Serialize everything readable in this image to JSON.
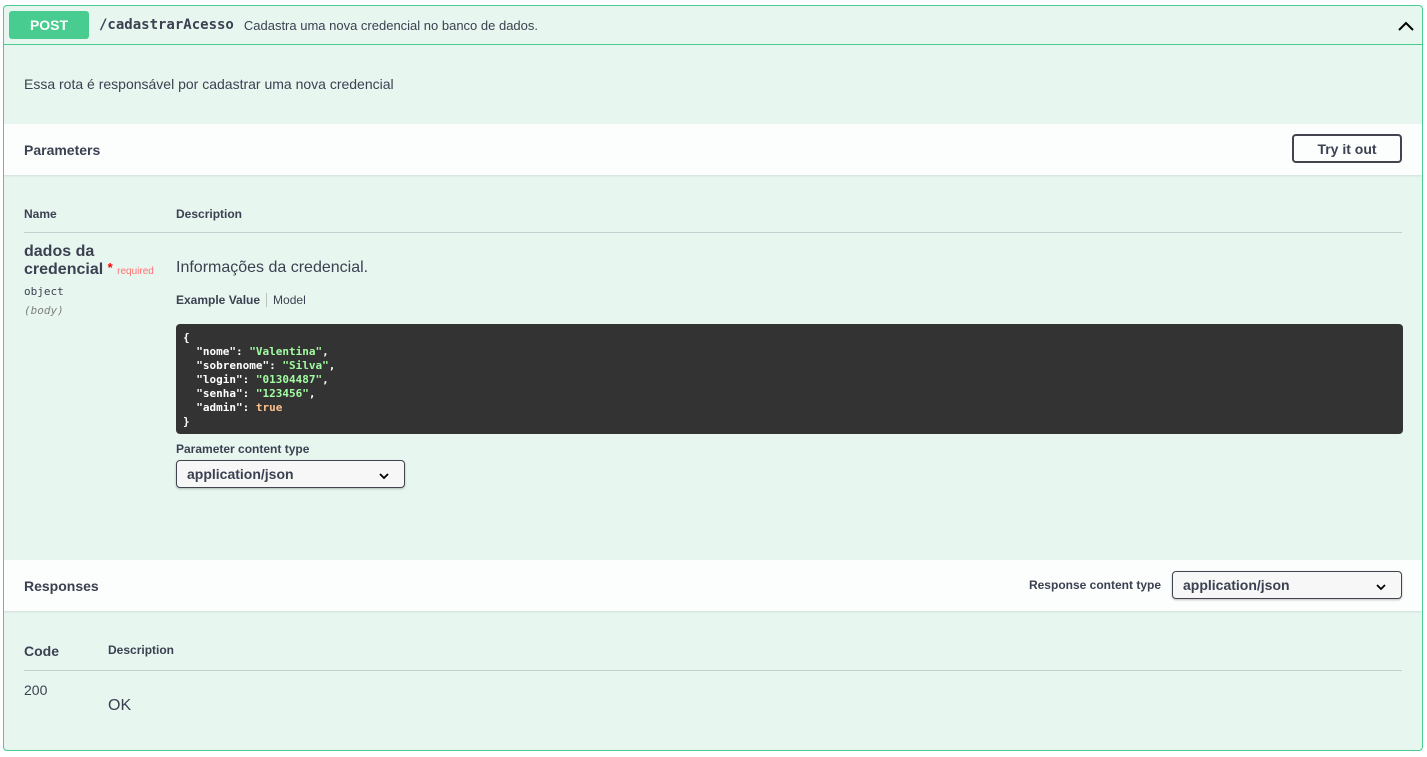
{
  "operation": {
    "method": "POST",
    "path": "/cadastrarAcesso",
    "summary": "Cadastra uma nova credencial no banco de dados.",
    "description": "Essa rota é responsável por cadastrar uma nova credencial",
    "collapse_icon": "chevron-up-icon"
  },
  "parameters": {
    "title": "Parameters",
    "try_label": "Try it out",
    "col_name": "Name",
    "col_description": "Description",
    "items": [
      {
        "name": "dados da credencial",
        "required_mark": "*",
        "required_label": "required",
        "type": "object",
        "in": "(body)",
        "description": "Informações da credencial.",
        "tab_example": "Example Value",
        "tab_model": "Model",
        "example": {
          "open": "{",
          "close": "}",
          "fields": [
            {
              "key": "\"nome\"",
              "value": "\"Valentina\"",
              "kind": "string",
              "sep": ","
            },
            {
              "key": "\"sobrenome\"",
              "value": "\"Silva\"",
              "kind": "string",
              "sep": ","
            },
            {
              "key": "\"login\"",
              "value": "\"01304487\"",
              "kind": "string",
              "sep": ","
            },
            {
              "key": "\"senha\"",
              "value": "\"123456\"",
              "kind": "string",
              "sep": ","
            },
            {
              "key": "\"admin\"",
              "value": "true",
              "kind": "boolean",
              "sep": ""
            }
          ]
        },
        "content_type_label": "Parameter content type",
        "content_type_value": "application/json"
      }
    ]
  },
  "responses": {
    "title": "Responses",
    "content_type_label": "Response content type",
    "content_type_value": "application/json",
    "col_code": "Code",
    "col_description": "Description",
    "items": [
      {
        "code": "200",
        "description": "OK"
      }
    ]
  },
  "colors": {
    "post_accent": "#49cc90",
    "post_bg": "#e8f6f0",
    "code_bg": "#333333"
  }
}
